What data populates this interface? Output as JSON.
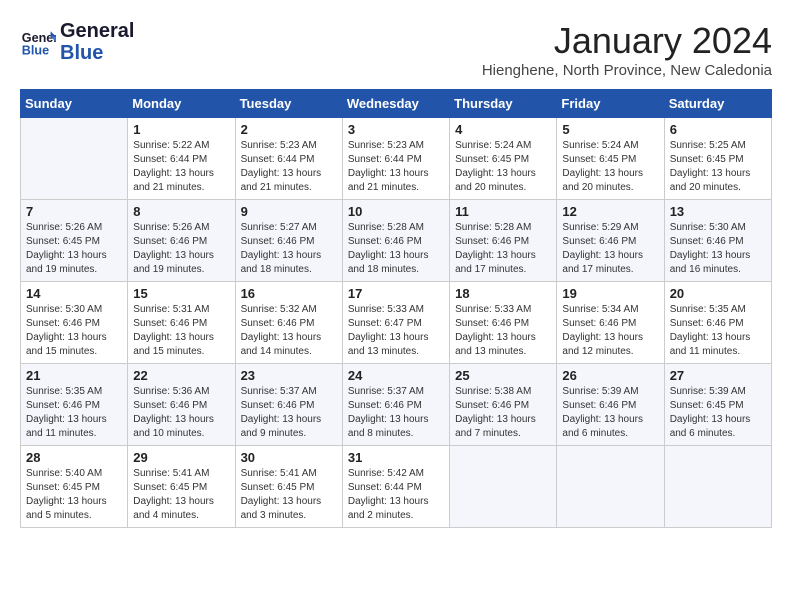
{
  "header": {
    "logo_line1": "General",
    "logo_line2": "Blue",
    "month": "January 2024",
    "location": "Hienghene, North Province, New Caledonia"
  },
  "days_of_week": [
    "Sunday",
    "Monday",
    "Tuesday",
    "Wednesday",
    "Thursday",
    "Friday",
    "Saturday"
  ],
  "weeks": [
    [
      {
        "day": "",
        "info": ""
      },
      {
        "day": "1",
        "info": "Sunrise: 5:22 AM\nSunset: 6:44 PM\nDaylight: 13 hours\nand 21 minutes."
      },
      {
        "day": "2",
        "info": "Sunrise: 5:23 AM\nSunset: 6:44 PM\nDaylight: 13 hours\nand 21 minutes."
      },
      {
        "day": "3",
        "info": "Sunrise: 5:23 AM\nSunset: 6:44 PM\nDaylight: 13 hours\nand 21 minutes."
      },
      {
        "day": "4",
        "info": "Sunrise: 5:24 AM\nSunset: 6:45 PM\nDaylight: 13 hours\nand 20 minutes."
      },
      {
        "day": "5",
        "info": "Sunrise: 5:24 AM\nSunset: 6:45 PM\nDaylight: 13 hours\nand 20 minutes."
      },
      {
        "day": "6",
        "info": "Sunrise: 5:25 AM\nSunset: 6:45 PM\nDaylight: 13 hours\nand 20 minutes."
      }
    ],
    [
      {
        "day": "7",
        "info": "Sunrise: 5:26 AM\nSunset: 6:45 PM\nDaylight: 13 hours\nand 19 minutes."
      },
      {
        "day": "8",
        "info": "Sunrise: 5:26 AM\nSunset: 6:46 PM\nDaylight: 13 hours\nand 19 minutes."
      },
      {
        "day": "9",
        "info": "Sunrise: 5:27 AM\nSunset: 6:46 PM\nDaylight: 13 hours\nand 18 minutes."
      },
      {
        "day": "10",
        "info": "Sunrise: 5:28 AM\nSunset: 6:46 PM\nDaylight: 13 hours\nand 18 minutes."
      },
      {
        "day": "11",
        "info": "Sunrise: 5:28 AM\nSunset: 6:46 PM\nDaylight: 13 hours\nand 17 minutes."
      },
      {
        "day": "12",
        "info": "Sunrise: 5:29 AM\nSunset: 6:46 PM\nDaylight: 13 hours\nand 17 minutes."
      },
      {
        "day": "13",
        "info": "Sunrise: 5:30 AM\nSunset: 6:46 PM\nDaylight: 13 hours\nand 16 minutes."
      }
    ],
    [
      {
        "day": "14",
        "info": "Sunrise: 5:30 AM\nSunset: 6:46 PM\nDaylight: 13 hours\nand 15 minutes."
      },
      {
        "day": "15",
        "info": "Sunrise: 5:31 AM\nSunset: 6:46 PM\nDaylight: 13 hours\nand 15 minutes."
      },
      {
        "day": "16",
        "info": "Sunrise: 5:32 AM\nSunset: 6:46 PM\nDaylight: 13 hours\nand 14 minutes."
      },
      {
        "day": "17",
        "info": "Sunrise: 5:33 AM\nSunset: 6:47 PM\nDaylight: 13 hours\nand 13 minutes."
      },
      {
        "day": "18",
        "info": "Sunrise: 5:33 AM\nSunset: 6:46 PM\nDaylight: 13 hours\nand 13 minutes."
      },
      {
        "day": "19",
        "info": "Sunrise: 5:34 AM\nSunset: 6:46 PM\nDaylight: 13 hours\nand 12 minutes."
      },
      {
        "day": "20",
        "info": "Sunrise: 5:35 AM\nSunset: 6:46 PM\nDaylight: 13 hours\nand 11 minutes."
      }
    ],
    [
      {
        "day": "21",
        "info": "Sunrise: 5:35 AM\nSunset: 6:46 PM\nDaylight: 13 hours\nand 11 minutes."
      },
      {
        "day": "22",
        "info": "Sunrise: 5:36 AM\nSunset: 6:46 PM\nDaylight: 13 hours\nand 10 minutes."
      },
      {
        "day": "23",
        "info": "Sunrise: 5:37 AM\nSunset: 6:46 PM\nDaylight: 13 hours\nand 9 minutes."
      },
      {
        "day": "24",
        "info": "Sunrise: 5:37 AM\nSunset: 6:46 PM\nDaylight: 13 hours\nand 8 minutes."
      },
      {
        "day": "25",
        "info": "Sunrise: 5:38 AM\nSunset: 6:46 PM\nDaylight: 13 hours\nand 7 minutes."
      },
      {
        "day": "26",
        "info": "Sunrise: 5:39 AM\nSunset: 6:46 PM\nDaylight: 13 hours\nand 6 minutes."
      },
      {
        "day": "27",
        "info": "Sunrise: 5:39 AM\nSunset: 6:45 PM\nDaylight: 13 hours\nand 6 minutes."
      }
    ],
    [
      {
        "day": "28",
        "info": "Sunrise: 5:40 AM\nSunset: 6:45 PM\nDaylight: 13 hours\nand 5 minutes."
      },
      {
        "day": "29",
        "info": "Sunrise: 5:41 AM\nSunset: 6:45 PM\nDaylight: 13 hours\nand 4 minutes."
      },
      {
        "day": "30",
        "info": "Sunrise: 5:41 AM\nSunset: 6:45 PM\nDaylight: 13 hours\nand 3 minutes."
      },
      {
        "day": "31",
        "info": "Sunrise: 5:42 AM\nSunset: 6:44 PM\nDaylight: 13 hours\nand 2 minutes."
      },
      {
        "day": "",
        "info": ""
      },
      {
        "day": "",
        "info": ""
      },
      {
        "day": "",
        "info": ""
      }
    ]
  ]
}
